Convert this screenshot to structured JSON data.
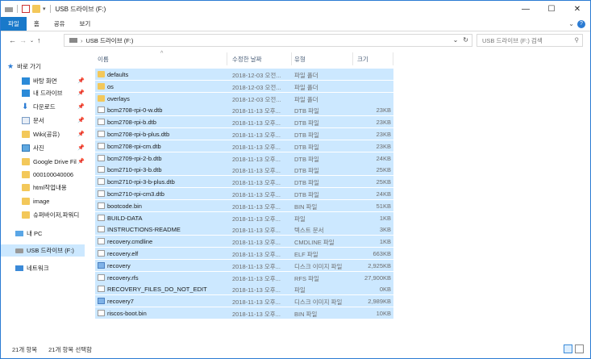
{
  "window": {
    "title": "USB 드라이브 (F:)",
    "controls": [
      "—",
      "☐",
      "✕"
    ]
  },
  "ribbon": {
    "tabs": [
      "파일",
      "홈",
      "공유",
      "보기"
    ]
  },
  "address": {
    "path": "USB 드라이브 (F:)",
    "search_placeholder": "USB 드라이브 (F:) 검색"
  },
  "nav": {
    "quick_access": "바로 가기",
    "items": [
      {
        "label": "바탕 화면",
        "icon": "desktop-icon",
        "pinned": true
      },
      {
        "label": "내 드라이브",
        "icon": "drive-icon",
        "pinned": true
      },
      {
        "label": "다운로드",
        "icon": "download-icon",
        "pinned": true
      },
      {
        "label": "문서",
        "icon": "document-icon",
        "pinned": true
      },
      {
        "label": "Wiki(공유)",
        "icon": "folder-icon",
        "pinned": true
      },
      {
        "label": "사진",
        "icon": "pictures-icon",
        "pinned": true
      },
      {
        "label": "Google Drive Fil",
        "icon": "folder-icon",
        "pinned": true
      },
      {
        "label": "000100040006",
        "icon": "folder-icon",
        "pinned": false
      },
      {
        "label": "html작업내용",
        "icon": "folder-icon",
        "pinned": false
      },
      {
        "label": "image",
        "icon": "folder-icon",
        "pinned": false
      },
      {
        "label": "슈퍼바이저,파워디",
        "icon": "folder-icon",
        "pinned": false
      }
    ],
    "this_pc": "내 PC",
    "usb": "USB 드라이브 (F:)",
    "network": "네트워크"
  },
  "columns": {
    "name": "이름",
    "date": "수정한 날짜",
    "type": "유형",
    "size": "크기"
  },
  "files": [
    {
      "name": "defaults",
      "date": "2018-12-03 오전...",
      "type": "파일 폴더",
      "size": "",
      "kind": "folder"
    },
    {
      "name": "os",
      "date": "2018-12-03 오전...",
      "type": "파일 폴더",
      "size": "",
      "kind": "folder"
    },
    {
      "name": "overlays",
      "date": "2018-12-03 오전...",
      "type": "파일 폴더",
      "size": "",
      "kind": "folder"
    },
    {
      "name": "bcm2708-rpi-0-w.dtb",
      "date": "2018-11-13 오후...",
      "type": "DTB 파일",
      "size": "23KB",
      "kind": "file"
    },
    {
      "name": "bcm2708-rpi-b.dtb",
      "date": "2018-11-13 오후...",
      "type": "DTB 파일",
      "size": "23KB",
      "kind": "file"
    },
    {
      "name": "bcm2708-rpi-b-plus.dtb",
      "date": "2018-11-13 오후...",
      "type": "DTB 파일",
      "size": "23KB",
      "kind": "file"
    },
    {
      "name": "bcm2708-rpi-cm.dtb",
      "date": "2018-11-13 오후...",
      "type": "DTB 파일",
      "size": "23KB",
      "kind": "file"
    },
    {
      "name": "bcm2709-rpi-2-b.dtb",
      "date": "2018-11-13 오후...",
      "type": "DTB 파일",
      "size": "24KB",
      "kind": "file"
    },
    {
      "name": "bcm2710-rpi-3-b.dtb",
      "date": "2018-11-13 오후...",
      "type": "DTB 파일",
      "size": "25KB",
      "kind": "file"
    },
    {
      "name": "bcm2710-rpi-3-b-plus.dtb",
      "date": "2018-11-13 오후...",
      "type": "DTB 파일",
      "size": "25KB",
      "kind": "file"
    },
    {
      "name": "bcm2710-rpi-cm3.dtb",
      "date": "2018-11-13 오후...",
      "type": "DTB 파일",
      "size": "24KB",
      "kind": "file"
    },
    {
      "name": "bootcode.bin",
      "date": "2018-11-13 오후...",
      "type": "BIN 파일",
      "size": "51KB",
      "kind": "file"
    },
    {
      "name": "BUILD-DATA",
      "date": "2018-11-13 오후...",
      "type": "파일",
      "size": "1KB",
      "kind": "file"
    },
    {
      "name": "INSTRUCTIONS-README",
      "date": "2018-11-13 오후...",
      "type": "텍스트 문서",
      "size": "3KB",
      "kind": "file"
    },
    {
      "name": "recovery.cmdline",
      "date": "2018-11-13 오후...",
      "type": "CMDLINE 파일",
      "size": "1KB",
      "kind": "file"
    },
    {
      "name": "recovery.elf",
      "date": "2018-11-13 오후...",
      "type": "ELF 파일",
      "size": "663KB",
      "kind": "file"
    },
    {
      "name": "recovery",
      "date": "2018-11-13 오후...",
      "type": "디스크 이미지 파일",
      "size": "2,925KB",
      "kind": "app"
    },
    {
      "name": "recovery.rfs",
      "date": "2018-11-13 오후...",
      "type": "RFS 파일",
      "size": "27,900KB",
      "kind": "file"
    },
    {
      "name": "RECOVERY_FILES_DO_NOT_EDIT",
      "date": "2018-11-13 오후...",
      "type": "파일",
      "size": "0KB",
      "kind": "file"
    },
    {
      "name": "recovery7",
      "date": "2018-11-13 오후...",
      "type": "디스크 이미지 파일",
      "size": "2,989KB",
      "kind": "app"
    },
    {
      "name": "riscos-boot.bin",
      "date": "2018-11-13 오후...",
      "type": "BIN 파일",
      "size": "10KB",
      "kind": "file"
    }
  ],
  "status": {
    "count": "21개 항목",
    "selected": "21개 항목 선택함"
  },
  "colors": {
    "selection": "#cce8ff",
    "accent": "#1979ca",
    "folder": "#f3c85a"
  }
}
